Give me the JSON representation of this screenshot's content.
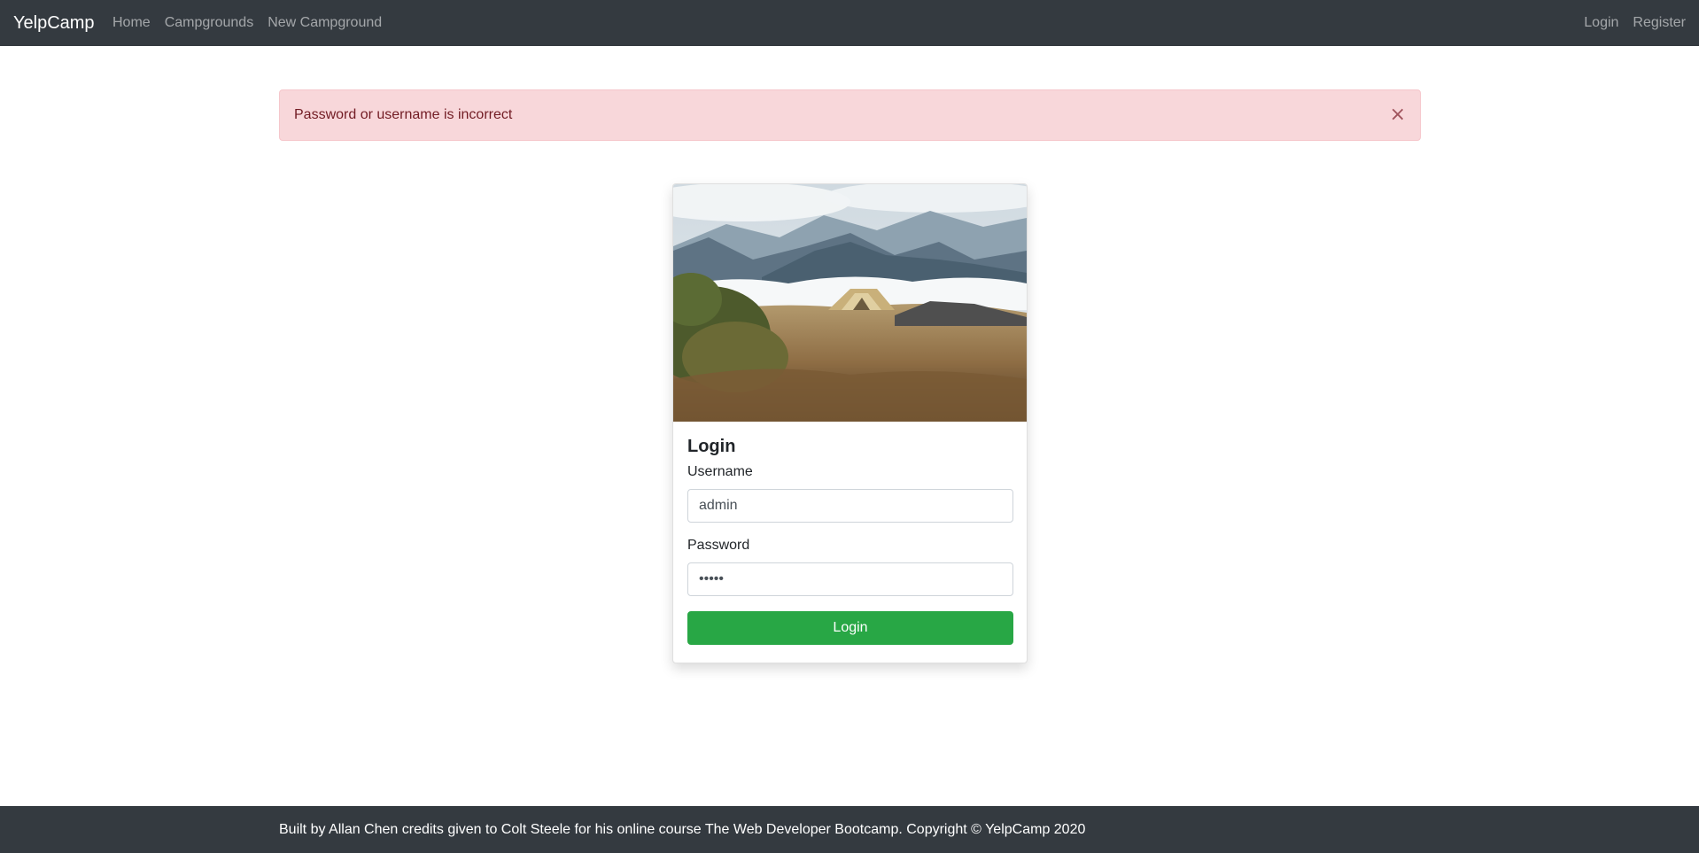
{
  "navbar": {
    "brand": "YelpCamp",
    "links_left": [
      "Home",
      "Campgrounds",
      "New Campground"
    ],
    "links_right": [
      "Login",
      "Register"
    ]
  },
  "alert": {
    "message": "Password or username is incorrect",
    "close_label": "×"
  },
  "login_card": {
    "image_icon": "mountain-tent-photo",
    "title": "Login",
    "username_label": "Username",
    "username_value": "admin",
    "password_label": "Password",
    "password_value": "•••••",
    "submit_label": "Login"
  },
  "footer": {
    "text": "Built by Allan Chen credits given to Colt Steele for his online course The Web Developer Bootcamp. Copyright © YelpCamp 2020"
  },
  "colors": {
    "navbar_bg": "#343a40",
    "alert_bg": "#f8d7da",
    "alert_text": "#721c24",
    "button_green": "#28a745"
  }
}
